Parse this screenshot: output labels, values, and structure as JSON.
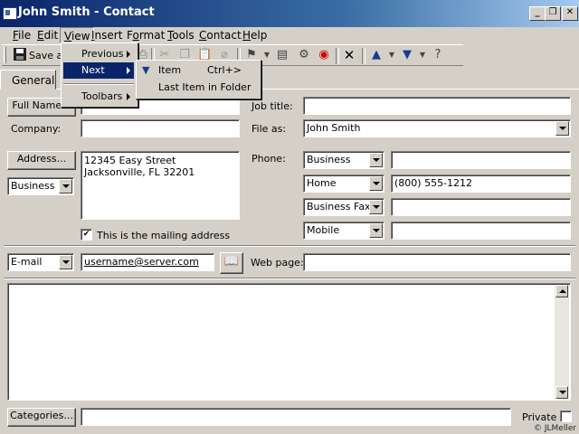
{
  "window": {
    "title": "John Smith - Contact",
    "controls": [
      "_",
      "̅□",
      "×"
    ]
  },
  "menubar": {
    "items": [
      {
        "label": "File",
        "key": "F",
        "rest": "ile"
      },
      {
        "label": "Edit",
        "key": "E",
        "rest": "dit"
      },
      {
        "label": "View",
        "key": "V",
        "rest": "iew"
      },
      {
        "label": "Insert",
        "key": "I",
        "rest": "nsert"
      },
      {
        "label": "Format",
        "key": "o",
        "pre": "F",
        "rest": "rmat"
      },
      {
        "label": "Tools",
        "key": "T",
        "rest": "ools"
      },
      {
        "label": "Contact",
        "key": "C",
        "rest": "ontact"
      },
      {
        "label": "Help",
        "key": "H",
        "rest": "elp"
      }
    ]
  },
  "toolbar": {
    "save_label": "Save a"
  },
  "tabs": {
    "general": "General"
  },
  "view_menu": {
    "previous": "Previous",
    "next": "Next",
    "toolbars": "Toolbars"
  },
  "next_submenu": {
    "item": "Item",
    "item_shortcut": "Ctrl+>",
    "last_item": "Last Item in Folder"
  },
  "form": {
    "full_name_button": "Full Name...",
    "company_label": "Company:",
    "company_value": "",
    "job_title_label": "Job title:",
    "job_title_value": "",
    "file_as_label": "File as:",
    "file_as_value": "John Smith",
    "address_button": "Address...",
    "address_line1": "12345 Easy Street",
    "address_line2": "Jacksonville, FL  32201",
    "address_type": "Business",
    "mailing_checkbox_label": "This is the mailing address",
    "mailing_checked": true,
    "phone_label": "Phone:",
    "phones": [
      {
        "type": "Business",
        "value": ""
      },
      {
        "type": "Home",
        "value": "(800) 555-1212"
      },
      {
        "type": "Business Fax",
        "value": ""
      },
      {
        "type": "Mobile",
        "value": ""
      }
    ],
    "email_type": "E-mail",
    "email_value": "username@server.com",
    "web_page_label": "Web page:",
    "web_page_value": "",
    "categories_button": "Categories...",
    "categories_value": "",
    "private_label": "Private",
    "private_checked": false
  },
  "watermark": "© JLMeller"
}
